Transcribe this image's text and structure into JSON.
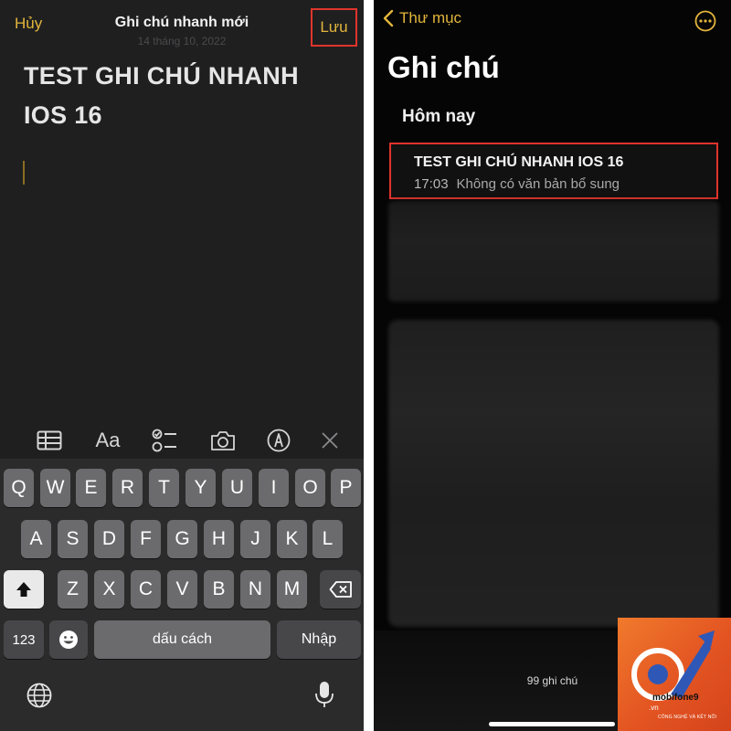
{
  "left": {
    "header": {
      "cancel_label": "Hủy",
      "title": "Ghi chú nhanh mới",
      "date": "14 tháng 10, 2022",
      "save_label": "Lưu"
    },
    "note_title": "TEST GHI CHÚ NHANH IOS 16",
    "toolbar": {
      "format_label": "Aa",
      "icons": [
        "table-icon",
        "text-format-icon",
        "checklist-icon",
        "camera-icon",
        "markup-icon",
        "close-icon"
      ]
    },
    "keyboard": {
      "row1": [
        "Q",
        "W",
        "E",
        "R",
        "T",
        "Y",
        "U",
        "I",
        "O",
        "P"
      ],
      "row2": [
        "A",
        "S",
        "D",
        "F",
        "G",
        "H",
        "J",
        "K",
        "L"
      ],
      "row3": [
        "Z",
        "X",
        "C",
        "V",
        "B",
        "N",
        "M"
      ],
      "numbers_label": "123",
      "space_label": "dấu cách",
      "return_label": "Nhập"
    }
  },
  "right": {
    "back_label": "Thư mục",
    "title": "Ghi chú",
    "section": "Hôm nay",
    "note": {
      "title": "TEST GHI CHÚ NHANH IOS 16",
      "time": "17:03",
      "preview": "Không có văn bản bổ sung"
    },
    "count_label": "99 ghi chú"
  },
  "logo": {
    "brand": "mobifone9",
    "tld": ".vn",
    "tagline": "CÔNG NGHỆ VÀ KẾT NỐI"
  },
  "colors": {
    "accent": "#e3b53c",
    "highlight_border": "#e0342c",
    "editor_bg": "#1f1f20",
    "list_bg": "#050505"
  }
}
